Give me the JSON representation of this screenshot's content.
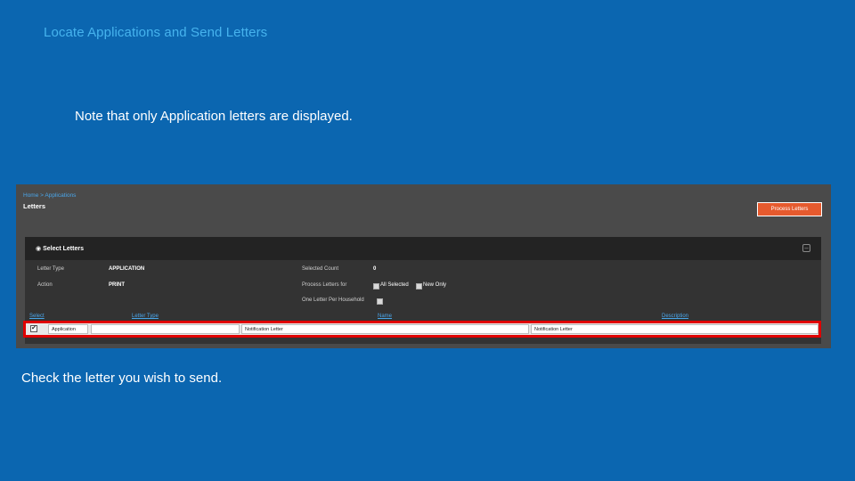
{
  "slide": {
    "title": "Locate Applications and Send Letters",
    "note": "Note that only Application letters are displayed.",
    "caption": "Check the letter you wish to send."
  },
  "app": {
    "breadcrumb": "Home > Applications",
    "page_title": "Letters",
    "process_button": "Process Letters",
    "section_title": "Select Letters",
    "fields": {
      "letter_type_label": "Letter Type",
      "letter_type_value": "APPLICATION",
      "action_label": "Action",
      "action_value": "PRINT",
      "selected_count_label": "Selected Count",
      "selected_count_value": "0",
      "process_for_label": "Process Letters for",
      "option_all_selected": "All Selected",
      "option_new_only": "New Only",
      "one_letter_label": "One Letter Per Household"
    },
    "table": {
      "headers": [
        "Select",
        "Letter Type",
        "Name",
        "Description"
      ],
      "rows": [
        {
          "checked": "✔",
          "letter_type": "Application",
          "name": "Notification Letter",
          "description": "Notification Letter"
        }
      ]
    }
  },
  "colors": {
    "background": "#0b66b0",
    "title": "#46b3ee",
    "accent_button": "#e65a2e",
    "highlight": "#e00000"
  }
}
